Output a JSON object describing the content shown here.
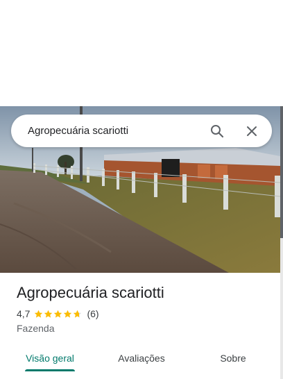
{
  "search": {
    "value": "Agropecuária scariotti",
    "search_icon": "search-icon",
    "close_icon": "close-icon"
  },
  "place": {
    "name": "Agropecuária scariotti",
    "rating": "4,7",
    "rating_value": 4.7,
    "reviews": "(6)",
    "category": "Fazenda"
  },
  "tabs": [
    {
      "label": "Visão geral",
      "active": true
    },
    {
      "label": "Avaliações",
      "active": false
    },
    {
      "label": "Sobre",
      "active": false
    }
  ],
  "colors": {
    "accent": "#00796b",
    "star": "#fbbc04",
    "text": "#202124"
  }
}
